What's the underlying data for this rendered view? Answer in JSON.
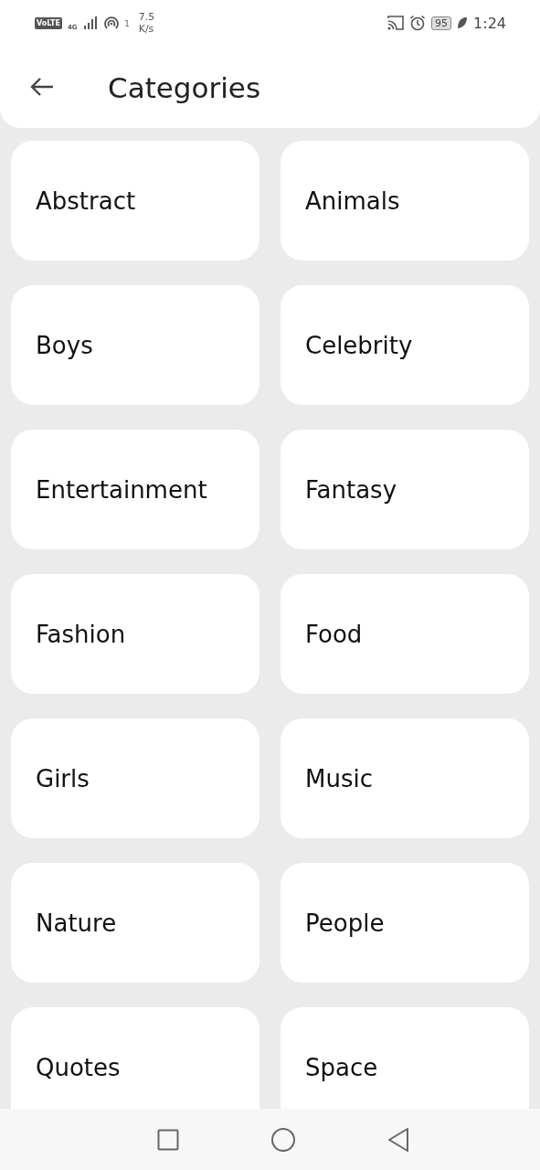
{
  "status_bar": {
    "volte": "VoLTE",
    "network": "4G",
    "hotspot_count": "1",
    "speed_value": "7.5",
    "speed_unit": "K/s",
    "battery": "95",
    "time": "1:24"
  },
  "header": {
    "title": "Categories"
  },
  "categories": [
    {
      "label": "Abstract"
    },
    {
      "label": "Animals"
    },
    {
      "label": "Boys"
    },
    {
      "label": "Celebrity"
    },
    {
      "label": "Entertainment"
    },
    {
      "label": "Fantasy"
    },
    {
      "label": "Fashion"
    },
    {
      "label": "Food"
    },
    {
      "label": "Girls"
    },
    {
      "label": "Music"
    },
    {
      "label": "Nature"
    },
    {
      "label": "People"
    },
    {
      "label": "Quotes"
    },
    {
      "label": "Space"
    }
  ]
}
